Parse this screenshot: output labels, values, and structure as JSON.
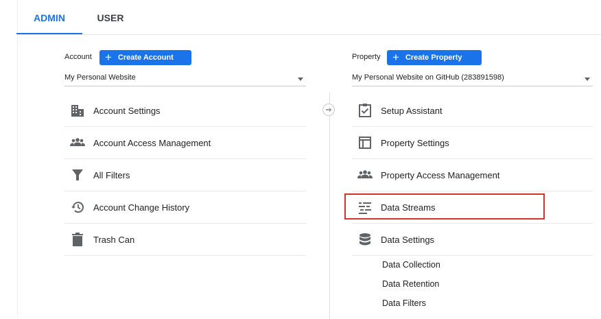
{
  "tabs": {
    "admin": "ADMIN",
    "user": "USER"
  },
  "account": {
    "label": "Account",
    "create_button": "Create Account",
    "selected": "My Personal Website",
    "menu": [
      {
        "label": "Account Settings",
        "icon": "building-icon"
      },
      {
        "label": "Account Access Management",
        "icon": "people-icon"
      },
      {
        "label": "All Filters",
        "icon": "filter-icon"
      },
      {
        "label": "Account Change History",
        "icon": "history-icon"
      },
      {
        "label": "Trash Can",
        "icon": "trash-icon"
      }
    ]
  },
  "property": {
    "label": "Property",
    "create_button": "Create Property",
    "selected": "My Personal Website on GitHub (283891598)",
    "menu": [
      {
        "label": "Setup Assistant",
        "icon": "checkbox-icon"
      },
      {
        "label": "Property Settings",
        "icon": "layout-icon"
      },
      {
        "label": "Property Access Management",
        "icon": "people-icon"
      },
      {
        "label": "Data Streams",
        "icon": "streams-icon"
      },
      {
        "label": "Data Settings",
        "icon": "database-icon"
      }
    ],
    "submenu": [
      "Data Collection",
      "Data Retention",
      "Data Filters"
    ]
  },
  "colors": {
    "accent": "#1a73e8",
    "highlight": "#d93025",
    "icon": "#5f6368"
  }
}
